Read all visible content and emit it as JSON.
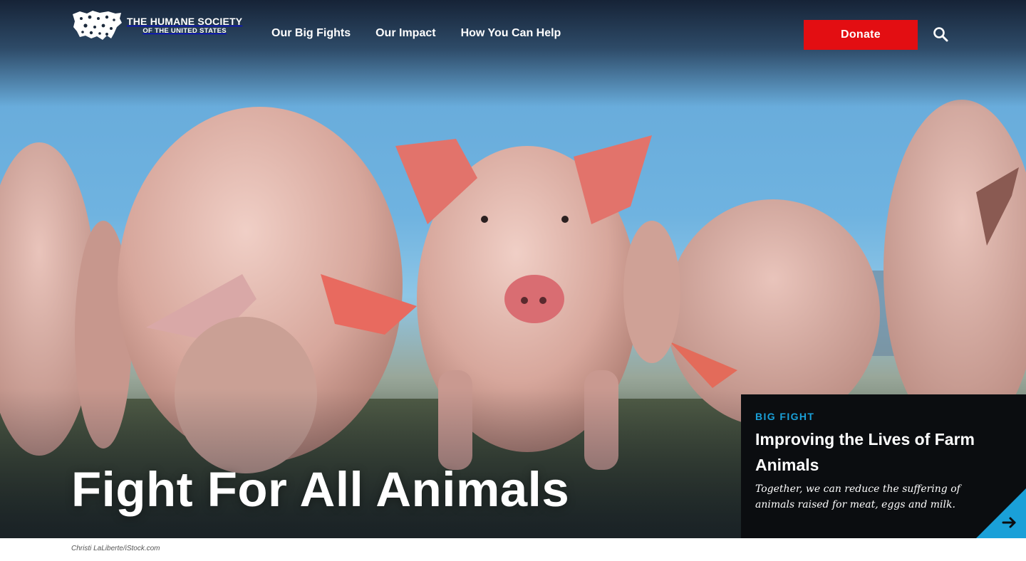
{
  "header": {
    "logo": {
      "line1": "THE HUMANE SOCIETY",
      "line2": "OF THE UNITED STATES",
      "icon": "animals-usa-map-icon"
    },
    "nav": [
      {
        "label": "Our Big Fights"
      },
      {
        "label": "Our Impact"
      },
      {
        "label": "How You Can Help"
      }
    ],
    "donate_label": "Donate",
    "search_icon": "search-icon"
  },
  "hero": {
    "headline": "Fight For All Animals",
    "photo_credit": "Christi LaLiberte/iStock.com"
  },
  "feature_card": {
    "eyebrow": "BIG FIGHT",
    "title": "Improving the Lives of Farm Animals",
    "description": "Together, we can reduce the suffering of animals raised for meat, eggs and milk.",
    "arrow_icon": "arrow-right-icon"
  },
  "colors": {
    "donate": "#e30e12",
    "eyebrow": "#1aa0d8",
    "card_bg": "#0b0d10",
    "corner": "#1aa0d8"
  }
}
